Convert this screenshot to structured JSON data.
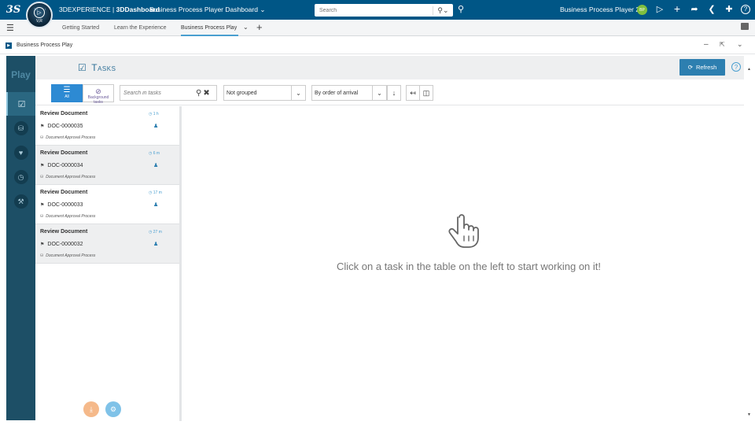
{
  "topbar": {
    "brand_prefix": "3DEXPERIENCE | ",
    "brand_bold": "3DDashboard",
    "dashboard_title": "Business Process Player Dashboard",
    "search_placeholder": "Search",
    "user_name": "Business Process Player 2",
    "user_initials": "BP",
    "compass_version": "V,R",
    "icons": [
      "ds-logo-icon",
      "compass-icon",
      "chevron-down-icon",
      "search-icon",
      "tag-icon",
      "bell-icon",
      "plus-icon",
      "share-icon",
      "network-icon",
      "tools-icon",
      "help-icon"
    ]
  },
  "tabs": {
    "items": [
      {
        "label": "Getting Started"
      },
      {
        "label": "Learn the Experience"
      },
      {
        "label": "Business Process Play"
      }
    ],
    "active_index": 2
  },
  "widget": {
    "title": "Business Process Play"
  },
  "sidebar": {
    "logo": "Play",
    "items": [
      {
        "icon": "checkbox-icon",
        "active": true
      },
      {
        "icon": "process-icon",
        "active": false
      },
      {
        "icon": "heartbeat-icon",
        "active": false
      },
      {
        "icon": "clock-icon",
        "active": false
      },
      {
        "icon": "wrench-icon",
        "active": false
      }
    ]
  },
  "tasks": {
    "title": "Tasks",
    "refresh_label": "Refresh",
    "filter_all": "All",
    "filter_background": "Background tasks",
    "search_placeholder": "Search in tasks",
    "grouping": "Not grouped",
    "ordering": "By order of arrival",
    "items": [
      {
        "title": "Review Document",
        "age": "1 h",
        "doc": "DOC-0000035",
        "process": "Document Approval Process"
      },
      {
        "title": "Review Document",
        "age": "6 m",
        "doc": "DOC-0000034",
        "process": "Document Approval Process"
      },
      {
        "title": "Review Document",
        "age": "17 m",
        "doc": "DOC-0000033",
        "process": "Document Approval Process"
      },
      {
        "title": "Review Document",
        "age": "27 m",
        "doc": "DOC-0000032",
        "process": "Document Approval Process"
      }
    ]
  },
  "main": {
    "empty_message": "Click on a task in the table on the left to start working on it!"
  },
  "colors": {
    "topbar": "#005686",
    "sidebar": "#1d4f66",
    "accent": "#2d7fb0",
    "fab_download": "#f5b98a",
    "fab_share": "#7fc2e8"
  }
}
